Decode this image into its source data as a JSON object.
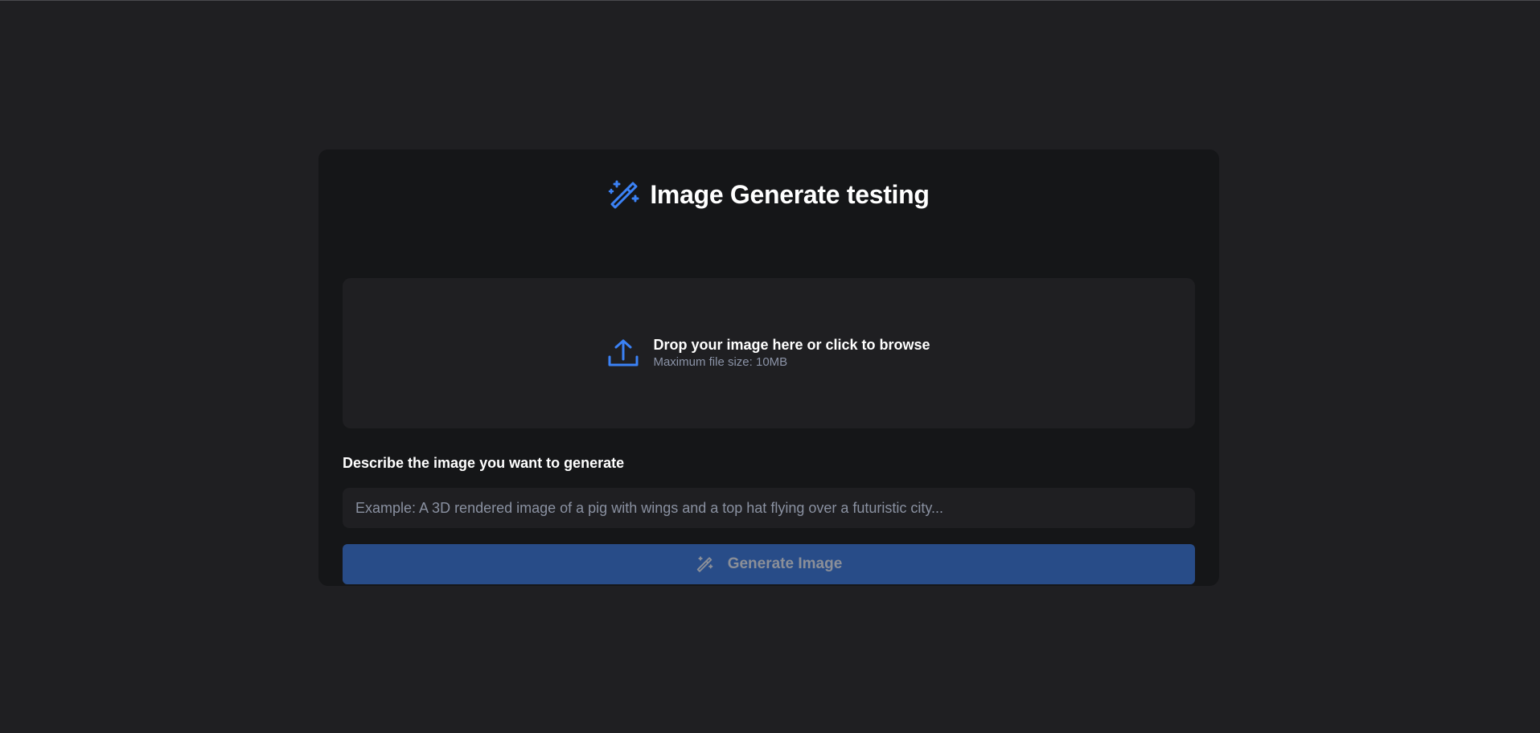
{
  "header": {
    "title": "Image Generate testing",
    "icon": "magic-wand-icon"
  },
  "dropzone": {
    "icon": "upload-icon",
    "title": "Drop your image here or click to browse",
    "subtitle": "Maximum file size: 10MB"
  },
  "prompt": {
    "label": "Describe the image you want to generate",
    "value": "",
    "placeholder": "Example: A 3D rendered image of a pig with wings and a top hat flying over a futuristic city..."
  },
  "generate_button": {
    "label": "Generate Image",
    "icon": "magic-wand-icon",
    "state": "disabled"
  },
  "colors": {
    "background": "#1f1f22",
    "card": "#151618",
    "accent": "#3b82f6",
    "button_disabled": "#284c88"
  }
}
